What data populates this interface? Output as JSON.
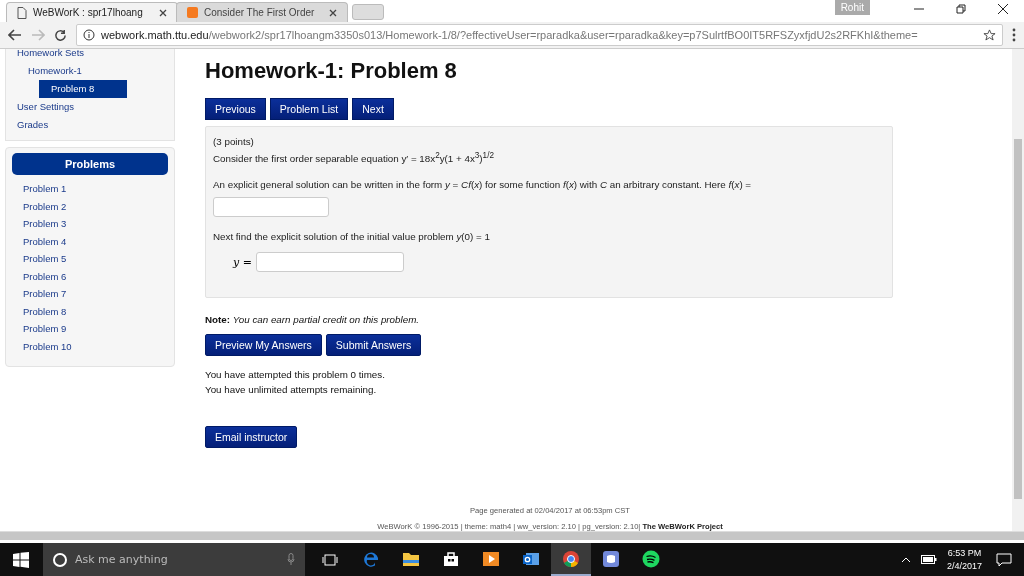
{
  "browser": {
    "tabs": [
      {
        "title": "WeBWorK : spr17lhoang",
        "kind": "page",
        "selected": true
      },
      {
        "title": "Consider The First Order",
        "kind": "chegg",
        "selected": false
      }
    ],
    "profile": "Rohit",
    "url": {
      "host": "webwork.math.ttu.edu",
      "path": "/webwork2/spr17lhoangm3350s013/Homework-1/8/?effectiveUser=rparadka&user=rparadka&key=p7SulrtfBO0IT5RFSZyxfjdU2s2RFKhI&theme="
    }
  },
  "sidebar": {
    "nav": [
      {
        "label": "Homework Sets",
        "selected": false,
        "children": [
          {
            "label": "Homework-1",
            "selected": false,
            "children": [
              {
                "label": "Problem 8",
                "selected": true
              }
            ]
          }
        ]
      },
      {
        "label": "User Settings",
        "selected": false
      },
      {
        "label": "Grades",
        "selected": false
      }
    ],
    "problems_title": "Problems",
    "problems": [
      "Problem 1",
      "Problem 2",
      "Problem 3",
      "Problem 4",
      "Problem 5",
      "Problem 6",
      "Problem 7",
      "Problem 8",
      "Problem 9",
      "Problem 10"
    ]
  },
  "page": {
    "title": "Homework-1: Problem 8",
    "nav_buttons": [
      "Previous",
      "Problem List",
      "Next"
    ],
    "problem": {
      "points": "(3 points)",
      "equation_text": "Consider the first order separable equation y′ = 18x$^{2}$y(1 + 4x$^{3}$)$^{1/2}$",
      "general_text": "An explicit general solution can be written in the form *y* = *Cf*(*x*) for some function *f*(*x*) with *C* an arbitrary constant. Here *f*(*x*) =",
      "ivp_text": "Next find the explicit solution of the initial value problem *y*(0) = 1",
      "answer_label": "*y* ="
    },
    "note": {
      "label": "Note:",
      "text": "You can earn partial credit on this problem."
    },
    "action_buttons": [
      "Preview My Answers",
      "Submit Answers"
    ],
    "attempts": [
      "You have attempted this problem 0 times.",
      "You have unlimited attempts remaining."
    ],
    "email_button": "Email instructor",
    "footer": {
      "generated": "Page generated at 02/04/2017 at 06:53pm CST",
      "info": "WeBWorK © 1996-2015 | theme: math4 | ww_version: 2.10 | pg_version: 2.10|",
      "link": "The WeBWorK Project"
    }
  },
  "taskbar": {
    "search_placeholder": "Ask me anything",
    "apps": [
      {
        "kind": "edge",
        "selected": false
      },
      {
        "kind": "explorer",
        "selected": false
      },
      {
        "kind": "store",
        "selected": false
      },
      {
        "kind": "media",
        "selected": false
      },
      {
        "kind": "outlook",
        "selected": false
      },
      {
        "kind": "chrome",
        "selected": true
      },
      {
        "kind": "discord",
        "selected": false
      },
      {
        "kind": "spotify",
        "selected": false
      }
    ],
    "time": "6:53 PM",
    "date": "2/4/2017"
  }
}
